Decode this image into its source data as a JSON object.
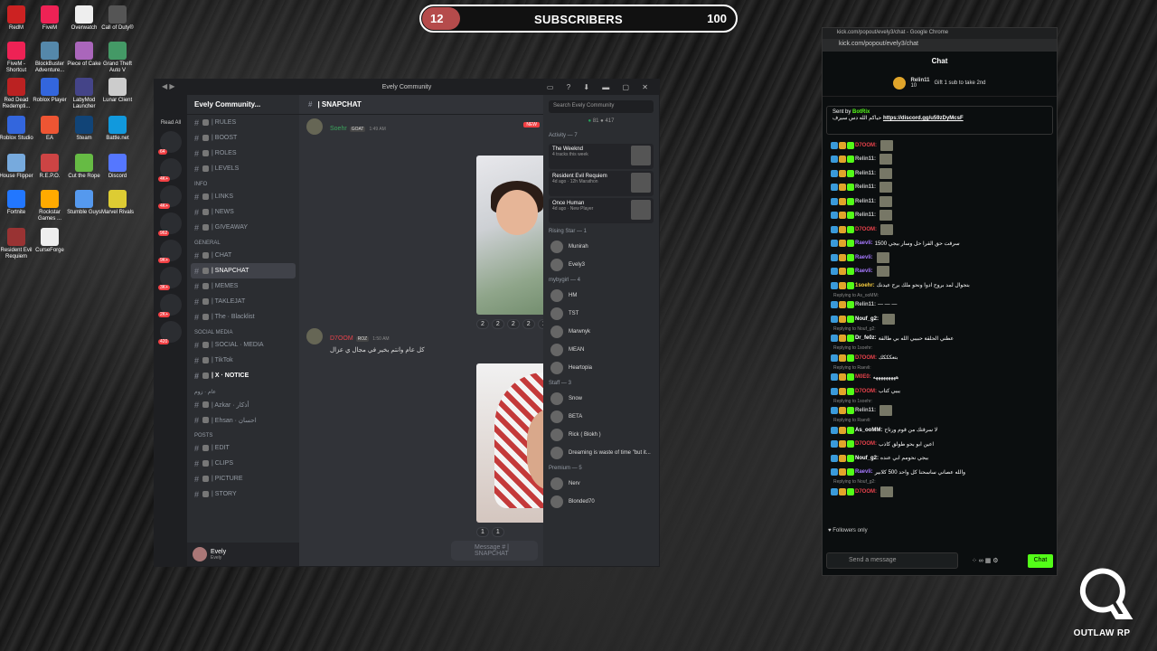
{
  "desktop": {
    "icons": [
      {
        "label": "RedM",
        "color": "#c22"
      },
      {
        "label": "FiveM",
        "color": "#e25"
      },
      {
        "label": "Overwatch",
        "color": "#eee"
      },
      {
        "label": "Call of Duty®",
        "color": "#555"
      },
      {
        "label": "FiveM - Shortcut",
        "color": "#e25"
      },
      {
        "label": "BlockBuster Adventure...",
        "color": "#58a"
      },
      {
        "label": "Piece of Cake",
        "color": "#a6b"
      },
      {
        "label": "Grand Theft Auto V",
        "color": "#496"
      },
      {
        "label": "Red Dead Redempti...",
        "color": "#b22"
      },
      {
        "label": "Roblox Player",
        "color": "#36d"
      },
      {
        "label": "LabyMod Launcher",
        "color": "#448"
      },
      {
        "label": "Lunar Client",
        "color": "#ccc"
      },
      {
        "label": "Roblox Studio",
        "color": "#36d"
      },
      {
        "label": "EA",
        "color": "#e53"
      },
      {
        "label": "Steam",
        "color": "#147"
      },
      {
        "label": "Battle.net",
        "color": "#19d"
      },
      {
        "label": "House Flipper",
        "color": "#7ad"
      },
      {
        "label": "R.E.P.O.",
        "color": "#c44"
      },
      {
        "label": "Cut the Rope",
        "color": "#6b4"
      },
      {
        "label": "Discord",
        "color": "#57f"
      },
      {
        "label": "Fortnite",
        "color": "#27f"
      },
      {
        "label": "Rockstar Games ...",
        "color": "#fa0"
      },
      {
        "label": "Stumble Guys",
        "color": "#59e"
      },
      {
        "label": "Marvel Rivals",
        "color": "#dc3"
      },
      {
        "label": "Resident Evil Requiem",
        "color": "#933"
      },
      {
        "label": "CurseForge",
        "color": "#eee"
      }
    ]
  },
  "subscribers": {
    "current": "12",
    "label": "SUBSCRIBERS",
    "goal": "100",
    "progress": 0.12,
    "fill_color": "#b54b4b"
  },
  "discord": {
    "window_title": "Evely Community",
    "server_name": "Evely Community...",
    "read_all": "Read All",
    "server_badges": [
      "64",
      "4K+",
      "4K+",
      "962",
      "9K+",
      "3K+",
      "2K+",
      "420"
    ],
    "categories": [
      {
        "name": "",
        "channels": [
          {
            "name": "| RULES",
            "sel": false
          },
          {
            "name": "| BOOST",
            "sel": false
          },
          {
            "name": "| ROLES",
            "sel": false
          },
          {
            "name": "| LEVELS",
            "sel": false
          }
        ]
      },
      {
        "name": "INFO",
        "channels": [
          {
            "name": "| LINKS",
            "sel": false
          },
          {
            "name": "| NEWS",
            "sel": false
          },
          {
            "name": "| GIVEAWAY",
            "sel": false
          }
        ]
      },
      {
        "name": "GENERAL",
        "channels": [
          {
            "name": "| CHAT",
            "sel": false
          },
          {
            "name": "| SNAPCHAT",
            "sel": true
          },
          {
            "name": "| MEMES",
            "sel": false
          },
          {
            "name": "| TAKLEJAT",
            "sel": false
          },
          {
            "name": "| The · Blacklist",
            "sel": false
          }
        ]
      },
      {
        "name": "SOCIAL MEDIA",
        "channels": [
          {
            "name": "| SOCIAL · MEDIA",
            "sel": false
          },
          {
            "name": "| TikTok",
            "sel": false
          },
          {
            "name": "| X · NOTICE",
            "sel": false,
            "bold": true
          }
        ]
      },
      {
        "name": "عام · زوم",
        "channels": [
          {
            "name": "| Azkar · أذكار",
            "sel": false
          },
          {
            "name": "| Ehsan · احسان",
            "sel": false
          }
        ]
      },
      {
        "name": "POSTS",
        "channels": [
          {
            "name": "| EDIT",
            "sel": false
          },
          {
            "name": "| CLIPS",
            "sel": false
          },
          {
            "name": "| PICTURE",
            "sel": false
          },
          {
            "name": "| STORY",
            "sel": false
          }
        ]
      }
    ],
    "current_channel": "| SNAPCHAT",
    "user": {
      "name": "Evely",
      "status": "Evely"
    },
    "messages": [
      {
        "author": "Soehr",
        "tag": "GOAT",
        "time": "1:49 AM",
        "text": "",
        "reactions": [
          "2",
          "2",
          "2",
          "2",
          "1"
        ]
      },
      {
        "author": "D7OOM",
        "tag": "ROZ",
        "time": "1:50 AM",
        "text": "كل عام وانتم بخير في مجال ي عزال",
        "reactions": [
          "1",
          "1"
        ]
      }
    ],
    "new_badge": "NEW",
    "composer_placeholder": "Message # | SNAPCHAT",
    "search_placeholder": "Search Evely Community",
    "online_count": "81",
    "member_count": "417",
    "activity_header": "Activity — 7",
    "activities": [
      {
        "title": "The Weeknd",
        "sub": "4 tracks this week"
      },
      {
        "title": "Resident Evil Requiem",
        "sub": "4d ago · 12h Marathon"
      },
      {
        "title": "Once Human",
        "sub": "4d ago · New Player"
      }
    ],
    "sections": [
      {
        "header": "Rising Star — 1",
        "members": [
          "Munirah",
          "Evely3"
        ]
      },
      {
        "header": "mybygirl — 4",
        "members": [
          "HM",
          "TST",
          "Marwnyk",
          "MEAN",
          "Heartopia"
        ]
      },
      {
        "header": "Staff — 3",
        "members": [
          "Snow",
          "BETA",
          "Rick ( Blokh )",
          "Dreaming is waste of time \"but it..."
        ]
      },
      {
        "header": "Premium — 5",
        "members": [
          "Nerv",
          "Blonded70"
        ]
      }
    ]
  },
  "kick": {
    "window_title": "kick.com/popout/evely3/chat - Google Chrome",
    "url": "kick.com/popout/evely3/chat",
    "header": "Chat",
    "gifter": "Relin11",
    "gift_count": "10",
    "gift_text": "Gift 1 sub to take 2nd",
    "pinned_by_label": "Sent by",
    "pinned_by": "BotRix",
    "pinned_text": "حياكم الله دس سيرف",
    "pinned_link": "https://discord.gg/u59zDyMcsF",
    "lines": [
      {
        "name": "D7OOM:",
        "color": "#e7424b",
        "text": "",
        "img": true
      },
      {
        "name": "Relin11:",
        "color": "#c6c6c6",
        "text": "",
        "img": true
      },
      {
        "name": "Relin11:",
        "color": "#c6c6c6",
        "text": "",
        "img": true
      },
      {
        "name": "Relin11:",
        "color": "#c6c6c6",
        "text": "",
        "img": true
      },
      {
        "name": "Relin11:",
        "color": "#c6c6c6",
        "text": "",
        "img": true
      },
      {
        "name": "Relin11:",
        "color": "#c6c6c6",
        "text": "",
        "img": true
      },
      {
        "name": "D7OOM:",
        "color": "#e7424b",
        "text": "",
        "img": true
      },
      {
        "name": "Raevli:",
        "color": "#a679ff",
        "text": "1500 سرقت حق القرا حل وسار بيجي",
        "img": false
      },
      {
        "name": "Raevli:",
        "color": "#a679ff",
        "text": "",
        "img": true
      },
      {
        "name": "Raevli:",
        "color": "#a679ff",
        "text": "",
        "img": true
      },
      {
        "name": "1soehr:",
        "color": "#ffd23f",
        "text": "بتجوال لمد بروح ادوا ونحو ملك برح عيدنك",
        "img": false
      },
      {
        "name": "Relin11:",
        "color": "#c6c6c6",
        "text": "— — —",
        "img": false,
        "reply": "Replying to As_ooMM:"
      },
      {
        "name": "Nouf_g2:",
        "color": "#fff",
        "text": "",
        "img": true
      },
      {
        "name": "Dr_fe0z:",
        "color": "#fff",
        "text": "عطني الحلقة حبيبي الله بي طالقة",
        "img": false,
        "reply": "Replying to Nouf_g2:"
      },
      {
        "name": "D7OOM:",
        "color": "#e7424b",
        "text": "بتعكككك",
        "img": false,
        "reply": "Replying to 1soehr:"
      },
      {
        "name": "M0E0:",
        "color": "#e7424b",
        "text": "هههههههههه",
        "img": false,
        "reply": "Replying to Raevli:"
      },
      {
        "name": "D7OOM:",
        "color": "#e7424b",
        "text": "يبيي كتاب",
        "img": false
      },
      {
        "name": "Relin11:",
        "color": "#c6c6c6",
        "text": "",
        "img": true,
        "reply": "Replying to 1soehr:"
      },
      {
        "name": "As_ooMM:",
        "color": "#fff",
        "text": "لا سرقتك من قوم ورتاح",
        "img": false,
        "reply": "Replying to Raevli:"
      },
      {
        "name": "D7OOM:",
        "color": "#e7424b",
        "text": "اعين ابو بحو طولق كاذب",
        "img": false
      },
      {
        "name": "Nouf_g2:",
        "color": "#fff",
        "text": "بيجي نحومم ابي عنده",
        "img": false
      },
      {
        "name": "Raevli:",
        "color": "#a679ff",
        "text": "والله عصاني ساسحنا كل واحد 500 كلابير",
        "img": false
      },
      {
        "name": "D7OOM:",
        "color": "#e7424b",
        "text": "",
        "img": true,
        "reply": "Replying to Nouf_g2:"
      }
    ],
    "followers_only": "Followers only",
    "input_placeholder": "Send a message",
    "chat_button": "Chat",
    "accent": "#53fc18"
  },
  "logo": {
    "text": "OUTLAW RP"
  }
}
